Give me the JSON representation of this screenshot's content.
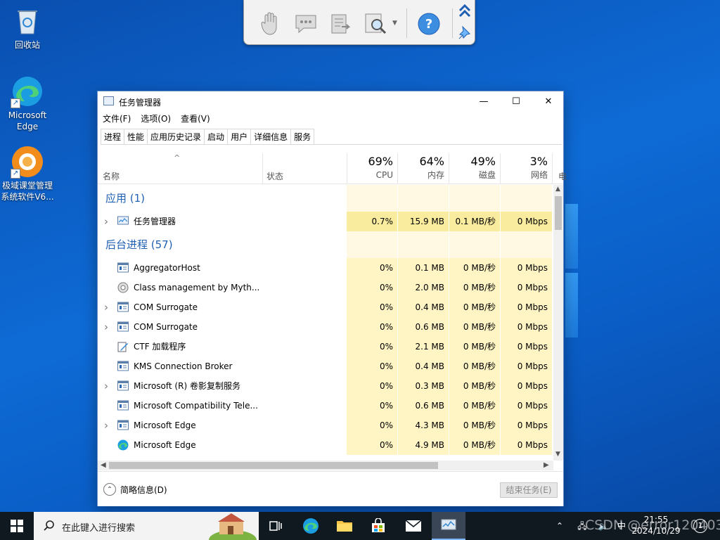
{
  "desktop": {
    "icons": [
      {
        "label": "回收站"
      },
      {
        "label": "Microsoft Edge"
      },
      {
        "label": "极域课堂管理系统软件V6..."
      }
    ]
  },
  "taskmgr": {
    "title": "任务管理器",
    "menu": [
      "文件(F)",
      "选项(O)",
      "查看(V)"
    ],
    "tabs": [
      "进程",
      "性能",
      "应用历史记录",
      "启动",
      "用户",
      "详细信息",
      "服务"
    ],
    "active_tab": "进程",
    "columns": {
      "name": "名称",
      "status": "状态",
      "cpu": {
        "pct": "69%",
        "label": "CPU"
      },
      "memory": {
        "pct": "64%",
        "label": "内存"
      },
      "disk": {
        "pct": "49%",
        "label": "磁盘"
      },
      "network": {
        "pct": "3%",
        "label": "网络"
      },
      "power_partial": "电"
    },
    "groups": {
      "apps": "应用 (1)",
      "background": "后台进程 (57)"
    },
    "app_rows": [
      {
        "name": "任务管理器",
        "cpu": "0.7%",
        "mem": "15.9 MB",
        "disk": "0.1 MB/秒",
        "net": "0 Mbps",
        "expandable": true,
        "icon": "taskmgr-icon"
      }
    ],
    "bg_rows": [
      {
        "name": "AggregatorHost",
        "cpu": "0%",
        "mem": "0.1 MB",
        "disk": "0 MB/秒",
        "net": "0 Mbps",
        "expandable": false,
        "icon": "service-icon"
      },
      {
        "name": "Class management by Myth...",
        "cpu": "0%",
        "mem": "2.0 MB",
        "disk": "0 MB/秒",
        "net": "0 Mbps",
        "expandable": false,
        "icon": "gear-icon"
      },
      {
        "name": "COM Surrogate",
        "cpu": "0%",
        "mem": "0.4 MB",
        "disk": "0 MB/秒",
        "net": "0 Mbps",
        "expandable": true,
        "icon": "service-icon"
      },
      {
        "name": "COM Surrogate",
        "cpu": "0%",
        "mem": "0.6 MB",
        "disk": "0 MB/秒",
        "net": "0 Mbps",
        "expandable": true,
        "icon": "service-icon"
      },
      {
        "name": "CTF 加载程序",
        "cpu": "0%",
        "mem": "2.1 MB",
        "disk": "0 MB/秒",
        "net": "0 Mbps",
        "expandable": false,
        "icon": "pen-icon"
      },
      {
        "name": "KMS Connection Broker",
        "cpu": "0%",
        "mem": "0.4 MB",
        "disk": "0 MB/秒",
        "net": "0 Mbps",
        "expandable": false,
        "icon": "service-icon"
      },
      {
        "name": "Microsoft (R) 卷影复制服务",
        "cpu": "0%",
        "mem": "0.3 MB",
        "disk": "0 MB/秒",
        "net": "0 Mbps",
        "expandable": true,
        "icon": "service-icon"
      },
      {
        "name": "Microsoft Compatibility Tele...",
        "cpu": "0%",
        "mem": "0.6 MB",
        "disk": "0 MB/秒",
        "net": "0 Mbps",
        "expandable": false,
        "icon": "service-icon"
      },
      {
        "name": "Microsoft Edge",
        "cpu": "0%",
        "mem": "4.3 MB",
        "disk": "0 MB/秒",
        "net": "0 Mbps",
        "expandable": true,
        "icon": "service-icon"
      },
      {
        "name": "Microsoft Edge",
        "cpu": "0%",
        "mem": "4.9 MB",
        "disk": "0 MB/秒",
        "net": "0 Mbps",
        "expandable": false,
        "icon": "edge-icon"
      }
    ],
    "footer": {
      "fewer_details": "简略信息(D)",
      "end_task": "结束任务(E)"
    }
  },
  "taskbar": {
    "search_placeholder": "在此键入进行搜索",
    "time": "21:55",
    "date": "2024/10/29",
    "watermark": "CSDN @error120403"
  },
  "colors": {
    "accent": "#1f5fb4",
    "heat_light": "#fff4c4",
    "heat_mid": "#f9ec9e"
  }
}
